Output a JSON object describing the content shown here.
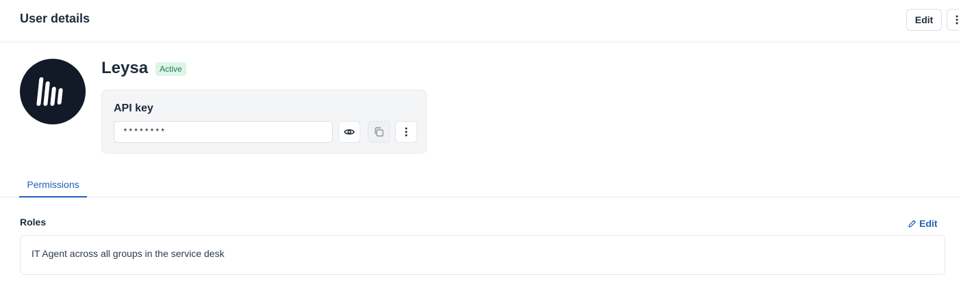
{
  "header": {
    "title": "User details",
    "edit_label": "Edit",
    "more_icon": "more-vertical-icon"
  },
  "user": {
    "name": "Leysa",
    "status": "Active",
    "avatar_icon": "logo-bars-icon"
  },
  "api_key": {
    "label": "API key",
    "value": "********",
    "actions": [
      "eye-icon",
      "copy-icon",
      "more-vertical-icon"
    ]
  },
  "tabs": [
    {
      "label": "Permissions",
      "active": true
    }
  ],
  "roles": {
    "title": "Roles",
    "edit_label": "Edit",
    "edit_icon": "pencil-icon",
    "description": "IT Agent across all groups in the service desk"
  },
  "colors": {
    "accent": "#1f5fb8",
    "status_bg": "#dcf5e9",
    "status_text": "#1f7a50",
    "avatar_bg": "#121a28"
  }
}
